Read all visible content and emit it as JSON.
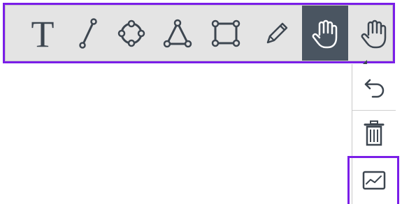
{
  "toolbar": {
    "tools": [
      {
        "name": "text-tool",
        "glyph": "T",
        "active": false
      },
      {
        "name": "line-tool",
        "active": false
      },
      {
        "name": "circle-tool",
        "active": false
      },
      {
        "name": "triangle-tool",
        "active": false
      },
      {
        "name": "rectangle-tool",
        "active": false
      },
      {
        "name": "pencil-tool",
        "active": false
      },
      {
        "name": "pan-tool",
        "active": true
      },
      {
        "name": "pan-tool-menu",
        "active": false
      }
    ]
  },
  "side_panel": {
    "buttons": [
      "undo",
      "delete",
      "chart"
    ]
  },
  "colors": {
    "highlight": "#7a1ee8",
    "toolbar_bg": "#e4e4e4",
    "active_bg": "#4a5561",
    "icon": "#3d4650"
  }
}
